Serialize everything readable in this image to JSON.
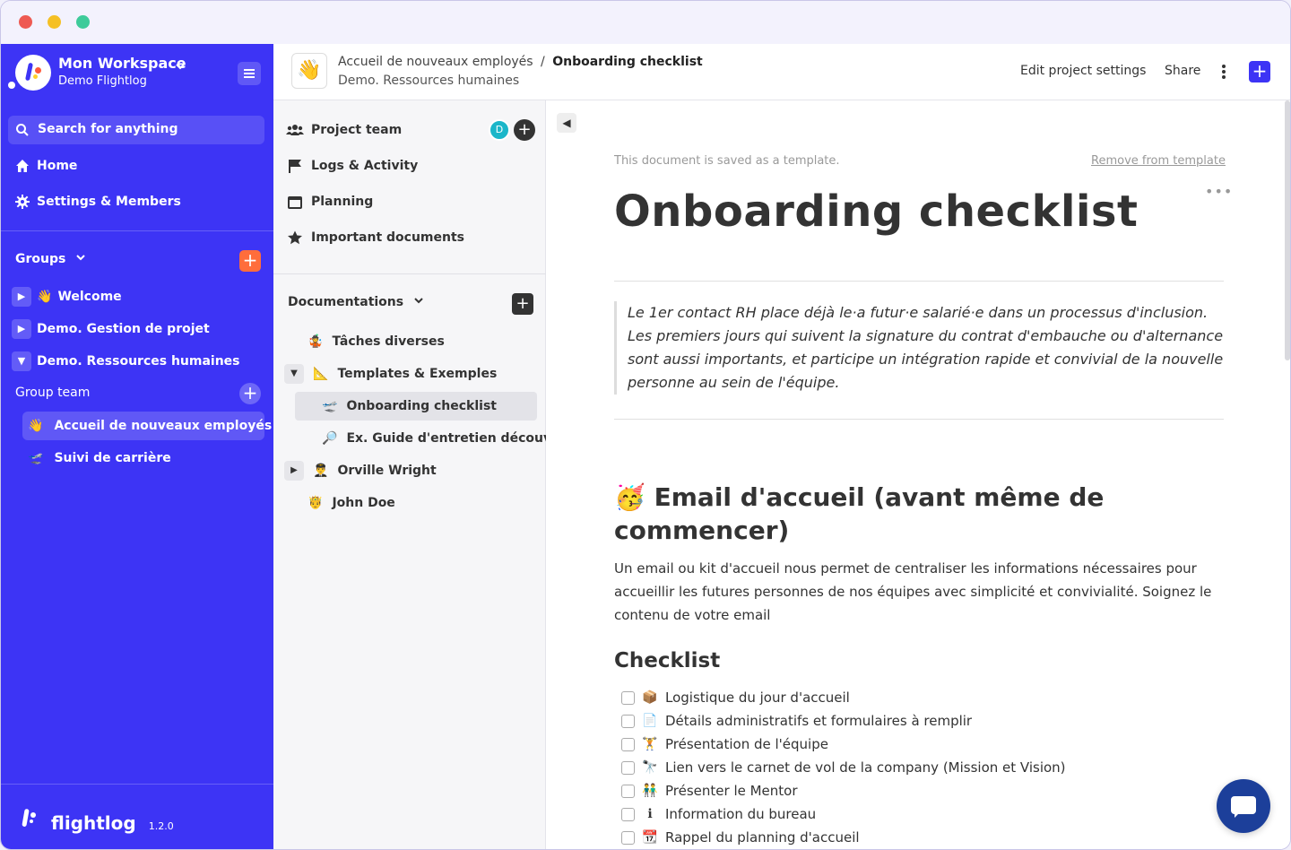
{
  "sidebar": {
    "workspace_name": "Mon Workspace",
    "workspace_sub": "Demo Flightlog",
    "search": "Search for anything",
    "nav": [
      {
        "label": "Home",
        "icon": "home-icon"
      },
      {
        "label": "Settings & Members",
        "icon": "gear-icon"
      }
    ],
    "groups_label": "Groups",
    "groups": [
      {
        "label": "Welcome",
        "emoji": "👋",
        "state": "collapsed"
      },
      {
        "label": "Demo. Gestion de projet",
        "state": "collapsed"
      },
      {
        "label": "Demo. Ressources humaines",
        "state": "expanded"
      }
    ],
    "group_team_label": "Group team",
    "projects": [
      {
        "label": "Accueil de nouveaux employés",
        "emoji": "👋",
        "active": true
      },
      {
        "label": "Suivi de carrière",
        "emoji": "🛫",
        "active": false
      }
    ],
    "brand": "flightlog",
    "version": "1.2.0"
  },
  "header": {
    "project_emoji": "👋",
    "breadcrumb_parent": "Accueil de nouveaux employés",
    "breadcrumb_sep": "/",
    "breadcrumb_current": "Onboarding checklist",
    "subtitle": "Demo. Ressources humaines",
    "edit_settings": "Edit project settings",
    "share": "Share"
  },
  "project_panel": {
    "items": [
      {
        "label": "Project team",
        "icon": "team-icon"
      },
      {
        "label": "Logs & Activity",
        "icon": "flag-icon"
      },
      {
        "label": "Planning",
        "icon": "calendar-icon"
      },
      {
        "label": "Important documents",
        "icon": "star-icon"
      }
    ],
    "team_avatar": "D",
    "docs_label": "Documentations",
    "docs": [
      {
        "label": "Tâches diverses",
        "emoji": "🤹"
      },
      {
        "label": "Templates & Exemples",
        "emoji": "📐"
      },
      {
        "label": "Onboarding checklist",
        "emoji": "🛫"
      },
      {
        "label": "Ex. Guide d'entretien découve...",
        "emoji": "🔎"
      },
      {
        "label": "Orville Wright",
        "emoji": "👨‍✈️"
      },
      {
        "label": "John Doe",
        "emoji": "🤴"
      }
    ]
  },
  "document": {
    "template_note": "This document is saved as a template.",
    "remove_template": "Remove from template",
    "title": "Onboarding checklist",
    "quote": "Le 1er contact RH place déjà le·a futur·e salarié·e dans un processus d'inclusion. Les premiers jours qui suivent la signature du contrat d'embauche ou d'alternance sont aussi importants, et participe un intégration rapide et convivial de la nouvelle personne au sein de l'équipe.",
    "section_emoji": "🥳",
    "section_title": "Email d'accueil (avant même de commencer)",
    "section_text": "Un email ou kit d'accueil nous permet de centraliser les informations nécessaires pour accueillir les futures personnes de nos équipes avec simplicité et convivialité. Soignez le contenu de votre email",
    "checklist_title": "Checklist",
    "checklist": [
      {
        "emoji": "📦",
        "text": "Logistique du jour d'accueil"
      },
      {
        "emoji": "📄",
        "text": "Détails administratifs et formulaires à remplir"
      },
      {
        "emoji": "🏋",
        "text": "Présentation de l'équipe"
      },
      {
        "emoji": "🔭",
        "text": "Lien vers le carnet de vol de la company (Mission et Vision)"
      },
      {
        "emoji": "👬",
        "text": "Présenter le Mentor"
      },
      {
        "emoji": "ℹ",
        "text": "Information du bureau"
      },
      {
        "emoji": "📆",
        "text": "Rappel du planning d'accueil"
      }
    ]
  }
}
